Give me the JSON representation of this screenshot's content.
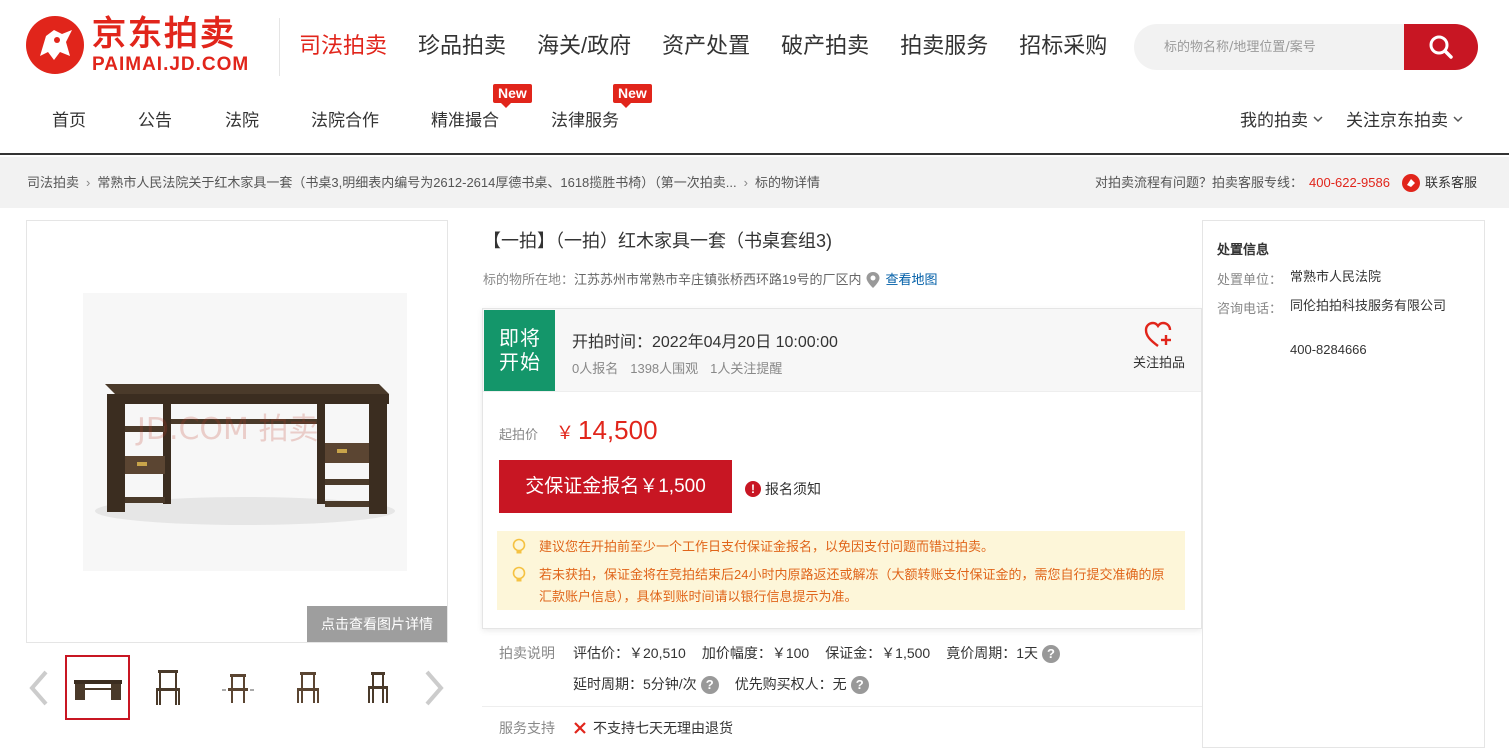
{
  "brand": {
    "cn": "京东拍卖",
    "en": "PAIMAI.JD.COM"
  },
  "main_nav": [
    "司法拍卖",
    "珍品拍卖",
    "海关/政府",
    "资产处置",
    "破产拍卖",
    "拍卖服务",
    "招标采购"
  ],
  "search": {
    "placeholder": "标的物名称/地理位置/案号"
  },
  "sub_nav": [
    {
      "label": "首页",
      "badge": ""
    },
    {
      "label": "公告",
      "badge": ""
    },
    {
      "label": "法院",
      "badge": ""
    },
    {
      "label": "法院合作",
      "badge": ""
    },
    {
      "label": "精准撮合",
      "badge": "New"
    },
    {
      "label": "法律服务",
      "badge": "New"
    }
  ],
  "user_links": [
    "我的拍卖",
    "关注京东拍卖"
  ],
  "breadcrumb": [
    "司法拍卖",
    "常熟市人民法院关于红木家具一套（书桌3,明细表内编号为2612-2614厚德书桌、1618揽胜书椅）（第一次拍卖...",
    "标的物详情"
  ],
  "help": {
    "question": "对拍卖流程有问题？拍卖客服专线：",
    "phone": "400-622-9586",
    "contact": "联系客服"
  },
  "gallery": {
    "watermark": "JD.COM 拍卖",
    "view_detail": "点击查看图片详情"
  },
  "item": {
    "title": "【一拍】（一拍）红木家具一套（书桌套组3)",
    "location_label": "标的物所在地：",
    "location": "江苏苏州市常熟市辛庄镇张桥西环路19号的厂区内",
    "map_link": "查看地图"
  },
  "auction": {
    "status": "即将开始",
    "start_time": "开拍时间：2022年04月20日 10:00:00",
    "signups": "0人报名",
    "watchers": "1398人围观",
    "reminders": "1人关注提醒",
    "follow_label": "关注拍品",
    "price_label": "起拍价",
    "currency": "￥",
    "start_price": "14,500",
    "deposit_button": "交保证金报名￥1,500",
    "notice_link": "报名须知",
    "tips": [
      "建议您在开拍前至少一个工作日支付保证金报名，以免因支付问题而错过拍卖。",
      "若未获拍，保证金将在竞拍结束后24小时内原路返还或解冻（大额转账支付保证金的，需您自行提交准确的原汇款账户信息），具体到账时间请以银行信息提示为准。"
    ]
  },
  "rules": {
    "label": "拍卖说明",
    "row1": [
      "评估价：￥20,510",
      "加价幅度：￥100",
      "保证金：￥1,500",
      "竟价周期：1天"
    ],
    "row2": [
      "延时周期：5分钟/次",
      "优先购买权人：无"
    ]
  },
  "service": {
    "label": "服务支持",
    "value": "不支持七天无理由退货"
  },
  "disposal": {
    "title": "处置信息",
    "unit_label": "处置单位：",
    "unit": "常熟市人民法院",
    "contact_label": "咨询电话：",
    "contact_org": "同伦拍拍科技服务有限公司",
    "contact_phone": "400-8284666"
  },
  "colors": {
    "brand_red": "#e1251b",
    "button_red": "#c81623",
    "status_green": "#14966a",
    "tip_bg": "#fdf6d9",
    "link_blue": "#005ea7"
  }
}
